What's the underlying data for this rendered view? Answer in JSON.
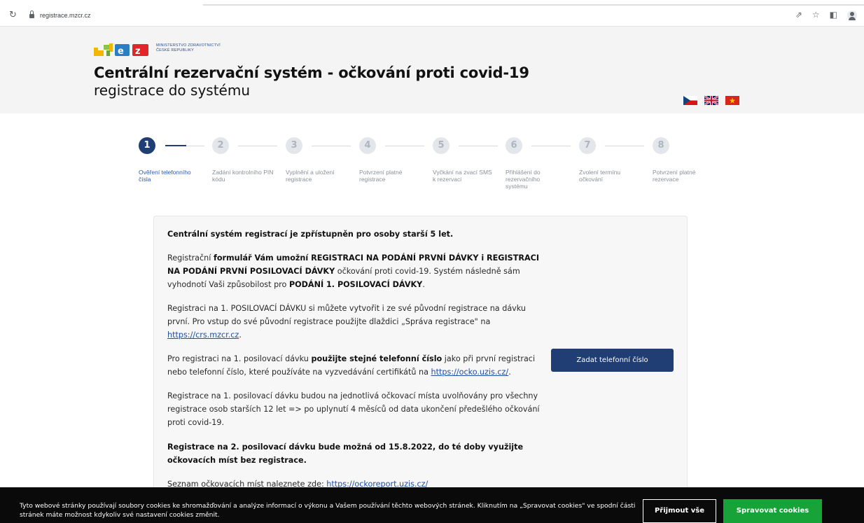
{
  "browser": {
    "url": "registrace.mzcr.cz"
  },
  "header": {
    "ministry_line1": "MINISTERSTVO ZDRAVOTNICTVÍ",
    "ministry_line2": "ČESKÉ REPUBLIKY",
    "title": "Centrální rezervační systém - očkování proti covid-19",
    "subtitle": "registrace do systému",
    "languages": [
      "cs",
      "en",
      "vi"
    ]
  },
  "steps": [
    {
      "number": "1",
      "label": "Ověření telefonního čísla",
      "active": true
    },
    {
      "number": "2",
      "label": "Zadání kontrolního PIN kódu",
      "active": false
    },
    {
      "number": "3",
      "label": "Vyplnění a uložení registrace",
      "active": false
    },
    {
      "number": "4",
      "label": "Potvrzení platné registrace",
      "active": false
    },
    {
      "number": "5",
      "label": "Vyčkání na zvací SMS k rezervaci",
      "active": false
    },
    {
      "number": "6",
      "label": "Přihlášení do rezervačního systému",
      "active": false
    },
    {
      "number": "7",
      "label": "Zvolení termínu očkování",
      "active": false
    },
    {
      "number": "8",
      "label": "Potvrzení platné rezervace",
      "active": false
    }
  ],
  "info": {
    "p1": "Centrální systém registrací je zpřístupněn pro osoby starší 5 let.",
    "p2_a": "Registrační ",
    "p2_b": "formulář Vám umožní REGISTRACI NA PODÁNÍ PRVNÍ DÁVKY i REGISTRACI NA PODÁNÍ PRVNÍ POSILOVACÍ DÁVKY",
    "p2_c": " očkování proti covid-19. Systém následně sám vyhodnotí Vaši způsobilost pro ",
    "p2_d": "PODÁNÍ 1. POSILOVACÍ DÁVKY",
    "p2_e": ".",
    "p3_a": "Registraci na 1. POSILOVACÍ DÁVKU si můžete vytvořit i ze své původní registrace na dávku první. Pro vstup do své původní registrace použijte dlaždici „Správa registrace\" na ",
    "p3_link": "https://crs.mzcr.cz",
    "p3_b": ".",
    "p4_a": "Pro registraci na 1. posilovací dávku ",
    "p4_b": "použijte stejné telefonní číslo",
    "p4_c": " jako při první registraci nebo telefonní číslo, které používáte na vyzvedávání certifikátů na ",
    "p4_link": "https://ocko.uzis.cz/",
    "p4_d": ".",
    "p5": "Registrace na 1. posilovací dávku budou na jednotlivá očkovací místa uvolňovány pro všechny registrace osob starších 12 let => po uplynutí 4 měsíců od data ukončení předešlého očkování proti covid-19.",
    "p6": "Registrace na 2. posilovací dávku bude možná od 15.8.2022, do té doby využijte očkovacích míst bez registrace.",
    "p7_a": "Seznam očkovacích míst naleznete zde: ",
    "p7_link": "https://ockoreport.uzis.cz/",
    "cta_label": "Zadat telefonní číslo"
  },
  "cookies": {
    "text": "Tyto webové stránky používají soubory cookies ke shromažďování a analýze informací o výkonu a Vašem používání těchto webových stránek. Kliknutím na „Spravovat cookies\" ve spodní části stránek máte možnost kdykoliv své nastavení cookies změnit.",
    "accept_label": "Přijmout vše",
    "manage_label": "Spravovat cookies"
  }
}
